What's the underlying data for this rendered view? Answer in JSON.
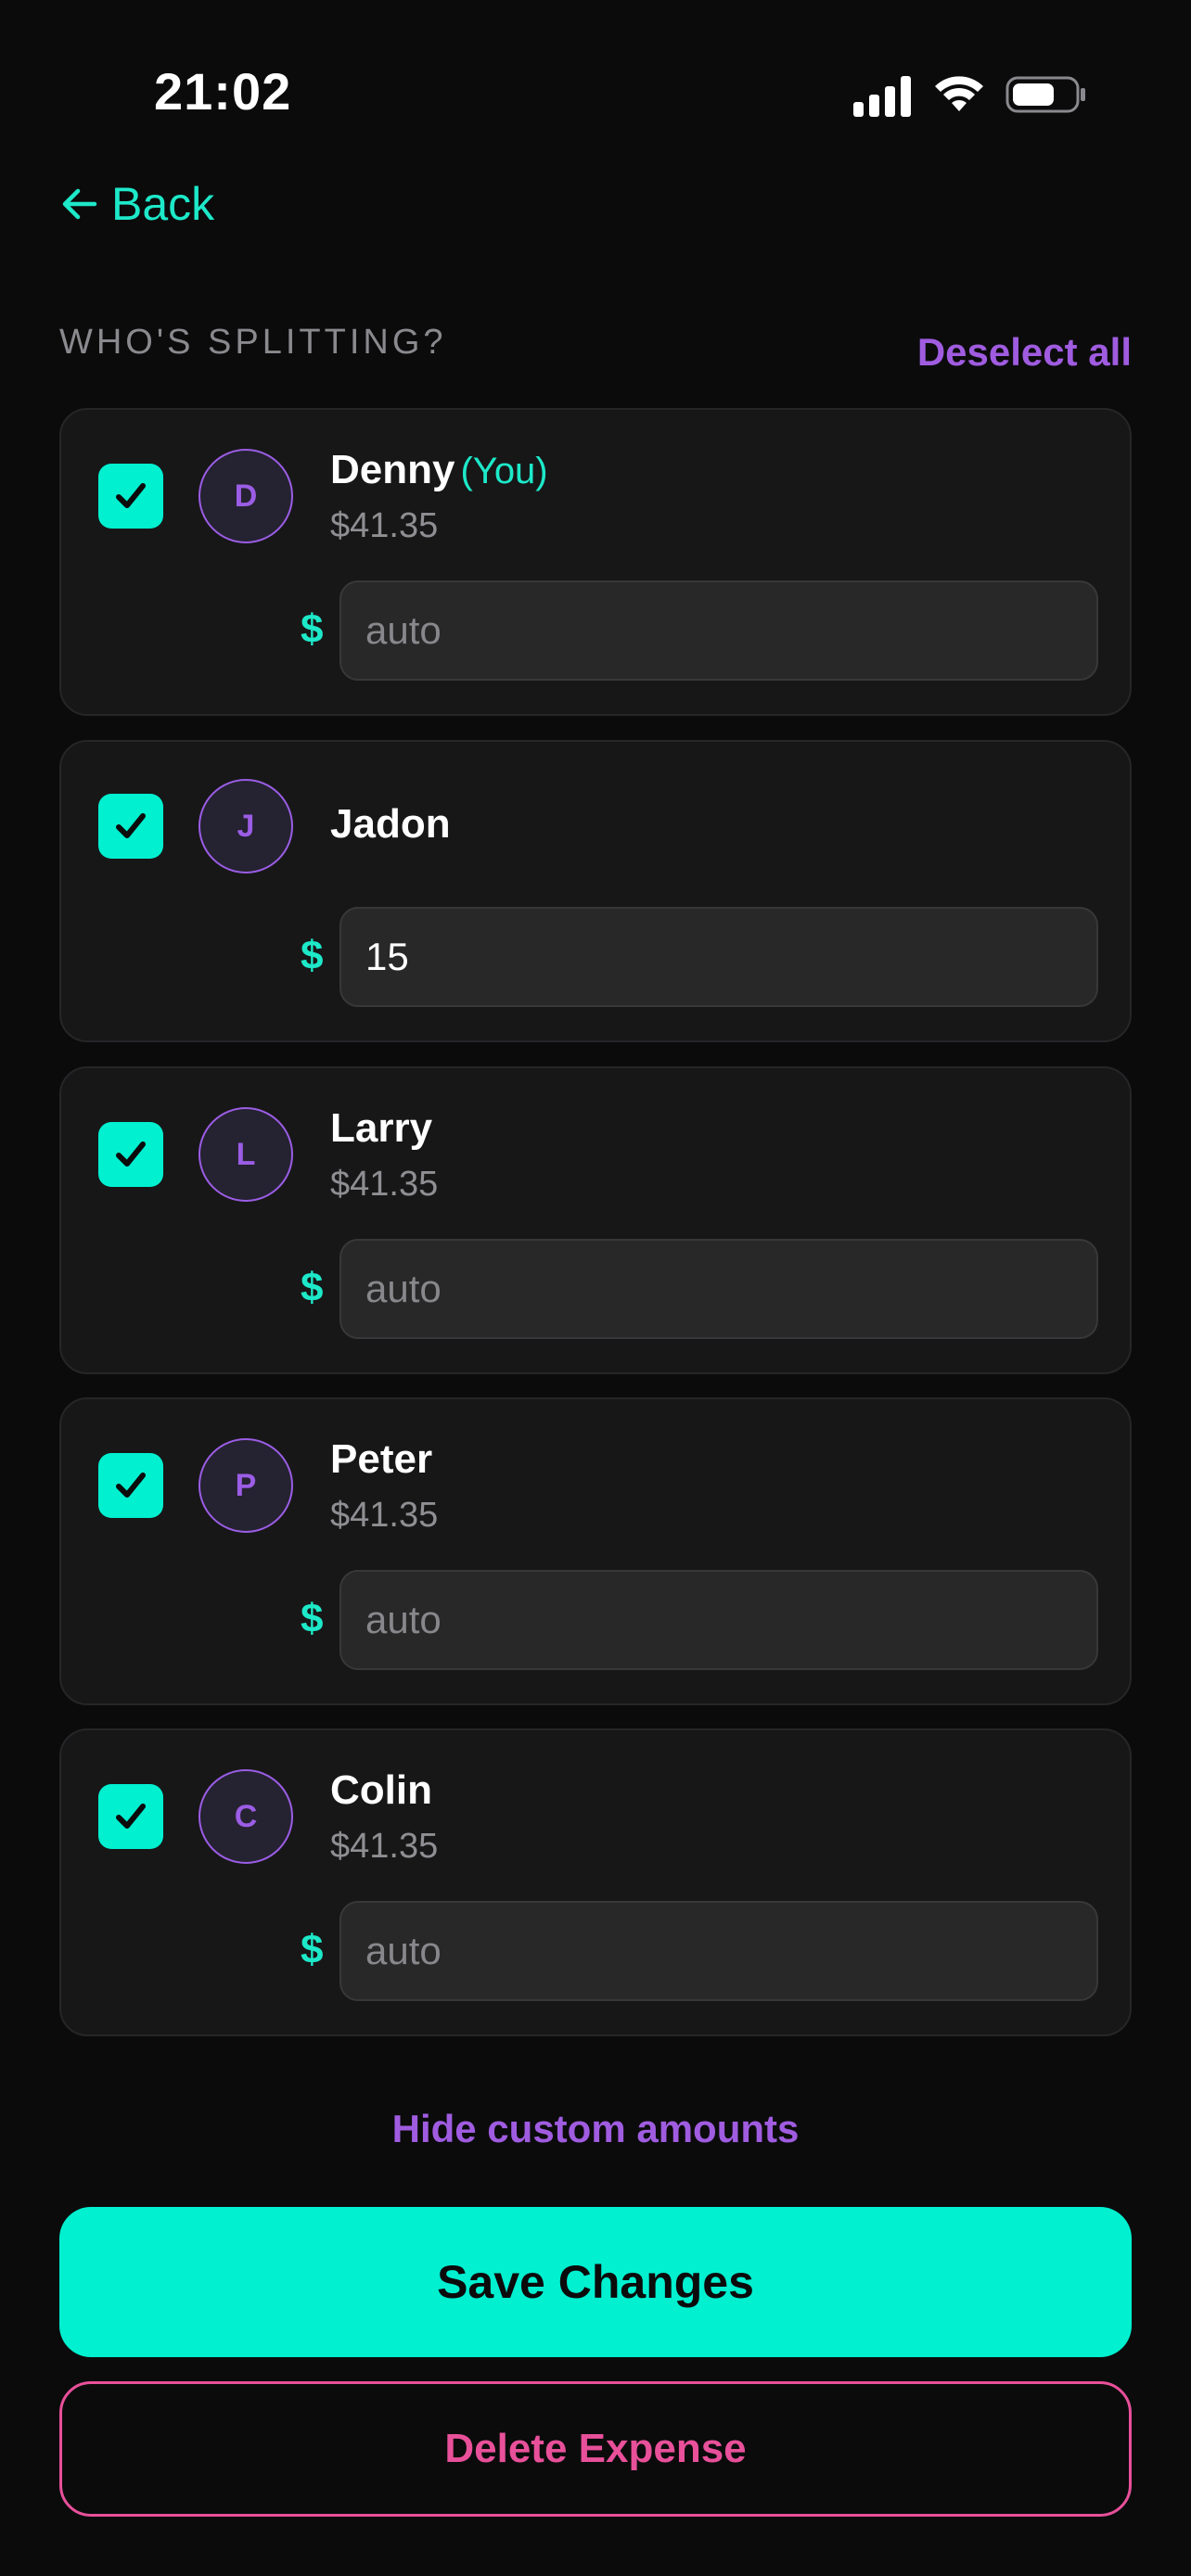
{
  "status_bar": {
    "time": "21:02",
    "icons": [
      "cellular-signal-icon",
      "wifi-icon",
      "battery-icon"
    ]
  },
  "nav": {
    "back_label": "Back",
    "back_icon": "arrow-left-icon"
  },
  "section": {
    "title": "WHO'S SPLITTING?",
    "deselect_label": "Deselect all"
  },
  "participants": [
    {
      "initial": "D",
      "name": "Denny",
      "you_tag": "(You)",
      "share": "$41.35",
      "currency": "$",
      "amount": "",
      "placeholder": "auto",
      "checked": true
    },
    {
      "initial": "J",
      "name": "Jadon",
      "you_tag": "",
      "share": "",
      "currency": "$",
      "amount": "15",
      "placeholder": "auto",
      "checked": true
    },
    {
      "initial": "L",
      "name": "Larry",
      "you_tag": "",
      "share": "$41.35",
      "currency": "$",
      "amount": "",
      "placeholder": "auto",
      "checked": true
    },
    {
      "initial": "P",
      "name": "Peter",
      "you_tag": "",
      "share": "$41.35",
      "currency": "$",
      "amount": "",
      "placeholder": "auto",
      "checked": true
    },
    {
      "initial": "C",
      "name": "Colin",
      "you_tag": "",
      "share": "$41.35",
      "currency": "$",
      "amount": "",
      "placeholder": "auto",
      "checked": true
    }
  ],
  "actions": {
    "toggle_custom_label": "Hide custom amounts",
    "save_label": "Save Changes",
    "delete_label": "Delete Expense"
  },
  "colors": {
    "accent": "#00f0d0",
    "purple": "#9b5de5",
    "danger": "#e8509a",
    "background": "#0b0b0c",
    "card": "#171718"
  }
}
